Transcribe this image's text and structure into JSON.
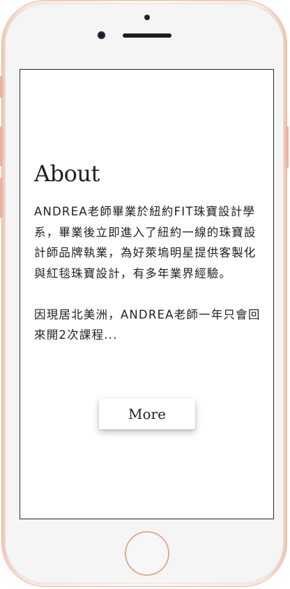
{
  "device": {
    "frame_color": "#f3cbbb",
    "screen_border_color": "#2a2a2a"
  },
  "about": {
    "title": "About",
    "paragraph1": "ANDREA老師畢業於紐約FIT珠寶設計學系，畢業後立即進入了紐約一線的珠寶設計師品牌執業，為好萊塢明星提供客製化與紅毯珠寶設計，有多年業界經驗。",
    "paragraph2": "因現居北美洲，ANDREA老師一年只會回來開2次課程..."
  },
  "more_button": {
    "label": "More"
  }
}
